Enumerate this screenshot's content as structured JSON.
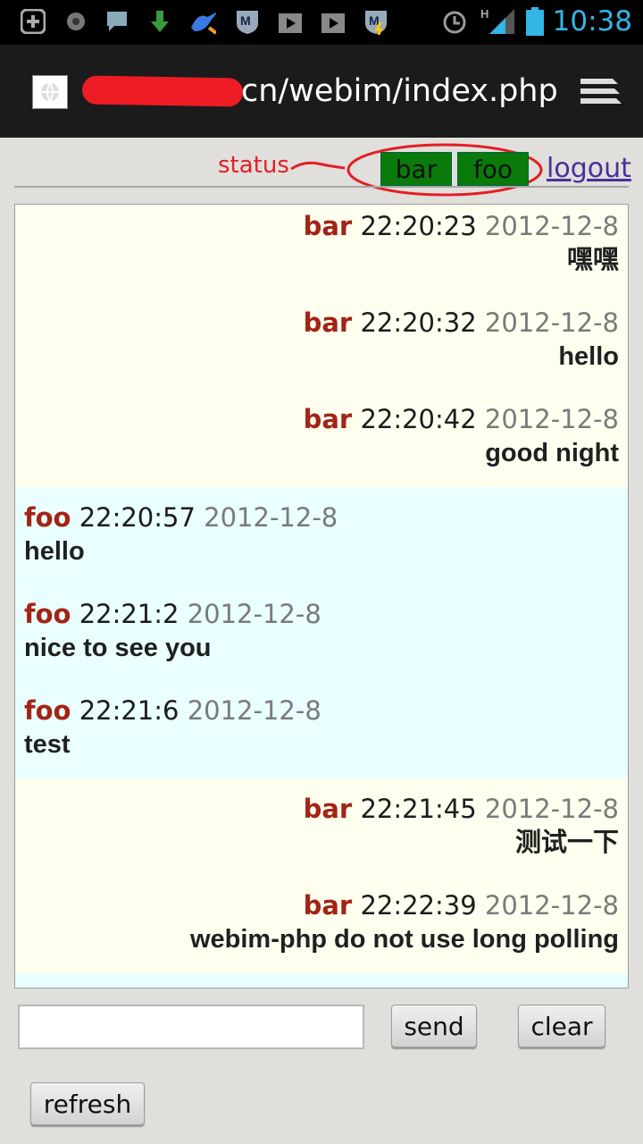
{
  "statusbar": {
    "time": "10:38",
    "network": "H",
    "icons": [
      "add-icon",
      "circle-icon",
      "chat-bubble-icon",
      "download-icon",
      "swordfish-icon",
      "shield-m-icon",
      "play-store-icon",
      "play-store-icon",
      "shield-m-icon",
      "alarm-icon",
      "signal-icon",
      "battery-icon"
    ]
  },
  "browser": {
    "url_visible": "cn/webim/index.php"
  },
  "annotation": {
    "label": "status"
  },
  "users": [
    {
      "name": "bar"
    },
    {
      "name": "foo"
    }
  ],
  "logout_label": "logout",
  "chat": {
    "groups": [
      {
        "side": "bar",
        "messages": [
          {
            "from": "bar",
            "time": "22:20:23",
            "date": "2012-12-8",
            "text": "嘿嘿"
          },
          {
            "from": "bar",
            "time": "22:20:32",
            "date": "2012-12-8",
            "text": "hello"
          },
          {
            "from": "bar",
            "time": "22:20:42",
            "date": "2012-12-8",
            "text": "good night"
          }
        ]
      },
      {
        "side": "foo",
        "messages": [
          {
            "from": "foo",
            "time": "22:20:57",
            "date": "2012-12-8",
            "text": "hello"
          },
          {
            "from": "foo",
            "time": "22:21:2",
            "date": "2012-12-8",
            "text": "nice to see you"
          },
          {
            "from": "foo",
            "time": "22:21:6",
            "date": "2012-12-8",
            "text": "test"
          }
        ]
      },
      {
        "side": "bar",
        "messages": [
          {
            "from": "bar",
            "time": "22:21:45",
            "date": "2012-12-8",
            "text": "测试一下"
          },
          {
            "from": "bar",
            "time": "22:22:39",
            "date": "2012-12-8",
            "text": "webim-php do not use long polling"
          }
        ]
      }
    ]
  },
  "controls": {
    "input_value": "",
    "send_label": "send",
    "clear_label": "clear",
    "refresh_label": "refresh"
  },
  "colors": {
    "accent_status": "#33b5e5",
    "user_button": "#0a7a0a",
    "sender_name": "#a32415",
    "annotation": "#e41e26",
    "bar_bg": "#fffff0",
    "foo_bg": "#eaffff"
  }
}
